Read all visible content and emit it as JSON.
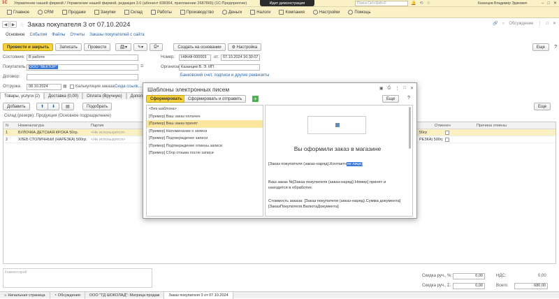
{
  "titlebar": {
    "app_title": "Управление нашей фирмой / Управление нашей фирмой, редакция 3.0 (абонент 838364, приложение 2687865) (1С:Предприятие)",
    "demo_badge": "Идет демонстрация",
    "search_placeholder": "Поиск Ctrl+Shift+F",
    "user": "Казанцев Владимир Эдикович"
  },
  "main_menu": [
    {
      "label": "Главное"
    },
    {
      "label": "CRM"
    },
    {
      "label": "Продажи"
    },
    {
      "label": "Закупки"
    },
    {
      "label": "Склад"
    },
    {
      "label": "Работы"
    },
    {
      "label": "Производство"
    },
    {
      "label": "Деньги"
    },
    {
      "label": "Налоги"
    },
    {
      "label": "Компания"
    },
    {
      "label": "Настройки"
    },
    {
      "label": "Помощь"
    }
  ],
  "document": {
    "title": "Заказ покупателя 3 от 07.10.2024",
    "discussions": "Обсуждение",
    "subnav": [
      "Основное",
      "События",
      "Файлы",
      "Отчеты",
      "Заказы покупателей с сайта"
    ]
  },
  "toolbar": {
    "post_close": "Провести и закрыть",
    "save": "Записать",
    "post": "Провести",
    "create_based": "Создать на основании",
    "settings": "Настройка",
    "more": "Еще"
  },
  "form": {
    "status_label": "Состояние:",
    "status_value": "В работе",
    "buyer_label": "Покупатель:",
    "buyer_value": "ООО \"ВЕКТОР\"",
    "contract_label": "Договор:",
    "shipment_label": "Отгрузка:",
    "shipment_value": "08.10.2024",
    "calc_label": "Калькуляция заказа",
    "calc_link": "Сюда ссылк...",
    "number_label": "Номер:",
    "number_value": "НФНФ-000003",
    "from_label": "от:",
    "date_value": "07.10.2024 16:30:07",
    "org_label": "Организация:",
    "org_value": "Казанцев В. Э. ИП",
    "bank_link": "Банковский счет, подписи и другие реквизиты"
  },
  "tabs": [
    "Товары, услуги (2)",
    "Доставка (0,00)",
    "Оплата (Вручную)",
    "Дополнительно"
  ],
  "grid_toolbar": {
    "add": "Добавить",
    "select": "Подобрать",
    "more": "Еще"
  },
  "warehouse": "Склад (резерв): Продукция (Основное подразделение)",
  "grid": {
    "headers": [
      "N",
      "Номенклатура",
      "Партия",
      "Отменен",
      "Причина отмены"
    ],
    "rows": [
      {
        "n": "1",
        "name": "БУЛОЧКА ДЕТСКАЯ КРОХА 50гр.",
        "batch": "<Не используется>",
        "tail": "50гр"
      },
      {
        "n": "2",
        "name": "ХЛЕБ СТОЛИЧНЫЙ (НАРЕЗКА) 500гр.",
        "batch": "<Не используется>",
        "tail": "РЕЗКА) 500гр"
      }
    ]
  },
  "comment_placeholder": "Комментарий",
  "totals": {
    "discount_pct_label": "Скидка руч., %:",
    "discount_pct": "0,00",
    "discount_sum_label": "Скидка руч., Σ:",
    "discount_sum": "0,00",
    "vat_label": "НДС:",
    "vat": "0,00",
    "total_label": "Всего:",
    "total": "680,00"
  },
  "taskbar": [
    "Начальная страница",
    "Обсуждения",
    "ООО \"ТД ШОКОЛАД\": Матрица продаж",
    "Заказ покупателя 3 от 07.10.2024"
  ],
  "modal": {
    "title": "Шаблоны электронных писем",
    "generate": "Сформировать",
    "generate_send": "Сформировать и отправить",
    "more": "Еще",
    "templates": [
      "<Без шаблона>",
      "[Пример] Ваш заказ оплачен",
      "[Пример] Ваш заказ принят",
      "[Пример] Напоминание о записи",
      "[Пример] Подтверждение записи",
      "[Пример] Подтверждение отмены записи",
      "[Пример] Сбор отзыва после записи"
    ],
    "preview": {
      "heading": "Вы оформили заказ в магазине",
      "line1_prefix": "[Заказ покупателя (заказ-наряд).Контактн",
      "line1_highlight": "ое лицо]",
      "line2": "Ваш заказ №[Заказ покупателя (заказ-наряд).Номер] принят и находится в обработке.",
      "line3": "Стоимость заказа: [Заказ покупателя (заказ-наряд).Сумма документа] [ЗаказПокупателя.ВалютаДокумента]"
    }
  }
}
